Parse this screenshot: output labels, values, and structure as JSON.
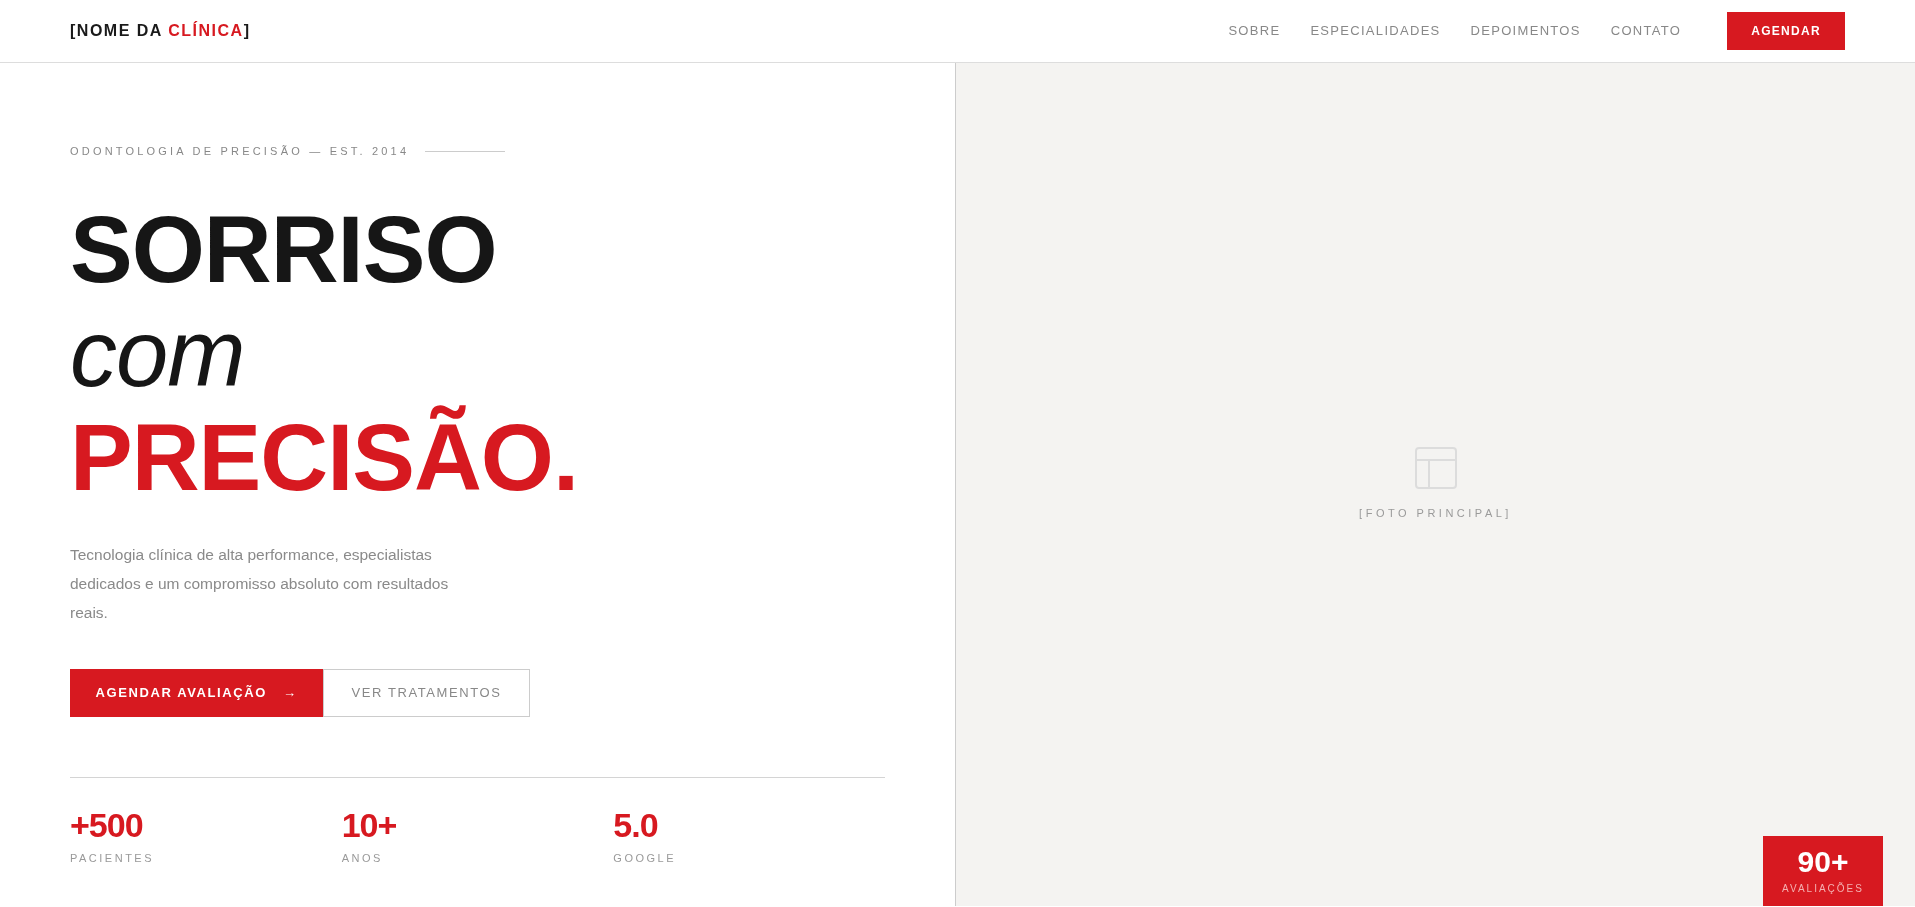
{
  "header": {
    "logo": {
      "prefix": "[NOME DA ",
      "highlight": "CLÍNICA",
      "suffix": "]"
    },
    "nav": [
      {
        "label": "SOBRE"
      },
      {
        "label": "ESPECIALIDADES"
      },
      {
        "label": "DEPOIMENTOS"
      },
      {
        "label": "CONTATO"
      }
    ],
    "cta": "AGENDAR"
  },
  "hero": {
    "eyebrow": "ODONTOLOGIA DE PRECISÃO — EST. 2014",
    "headline": [
      {
        "text": "SORRISO",
        "kind": "bold"
      },
      {
        "text": "com",
        "kind": "italic"
      },
      {
        "text": "PRECISÃO.",
        "kind": "accent"
      }
    ],
    "description": "Tecnologia clínica de alta performance, especialistas dedicados e um compromisso absoluto com resultados reais.",
    "buttons": [
      {
        "label": "AGENDAR AVALIAÇÃO",
        "arrow": "→",
        "kind": "primary"
      },
      {
        "label": "VER TRATAMENTOS",
        "kind": "outline"
      }
    ],
    "stats": [
      {
        "value": "+500",
        "label": "PACIENTES"
      },
      {
        "value": "10+",
        "label": "ANOS"
      },
      {
        "value": "5.0",
        "label": "GOOGLE"
      }
    ]
  },
  "photo": {
    "caption": "[FOTO PRINCIPAL]",
    "badge": {
      "value": "90+",
      "label": "AVALIAÇÕES"
    }
  }
}
